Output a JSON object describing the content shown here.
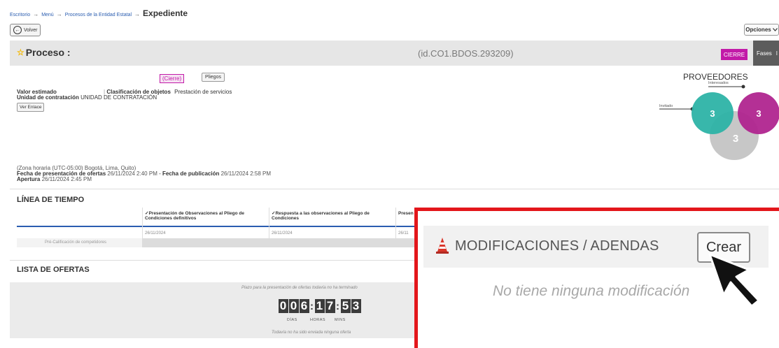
{
  "breadcrumb": {
    "items": [
      "Escritorio",
      "Menú",
      "Procesos de la Entidad Estatal"
    ],
    "current": "Expediente",
    "separator": "→"
  },
  "toolbar": {
    "back_label": "Volver",
    "options_label": "Opciones"
  },
  "process": {
    "title": "Proceso :",
    "id": "(id.CO1.BDOS.293209)",
    "badge": "CIERRE",
    "fases_label": "Fases",
    "state_label": "(Cierre)",
    "pliegos_label": "Pliegos",
    "valor_estimado_label": "Valor estimado",
    "clasificacion_label": "Clasificación de objetos",
    "clasificacion_value": "Prestación de servicios",
    "unidad_label": "Unidad de contratación",
    "unidad_value": "UNIDAD DE CONTRATACIÓN",
    "ver_enlace_label": "Ver Enlace",
    "zona_horaria": "(Zona horaria (UTC-05:00) Bogotá, Lima, Quito)",
    "fecha_presentacion_label": "Fecha de presentación de ofertas",
    "fecha_presentacion_value": "26/11/2024 2:40 PM",
    "dash": "-",
    "fecha_publicacion_label": "Fecha de publicación",
    "fecha_publicacion_value": "26/11/2024 2:58 PM",
    "apertura_label": "Apertura",
    "apertura_value": "26/11/2024 2:45 PM"
  },
  "proveedores": {
    "title": "PROVEEDORES",
    "interesados_label": "Interesados",
    "invitado_label": "Invitado",
    "counts": [
      "3",
      "3",
      "3"
    ],
    "colors": {
      "teal": "#2db3a7",
      "magenta": "#b0258f",
      "gray": "#c4c4c4"
    }
  },
  "timeline": {
    "title": "LÍNEA DE TIEMPO",
    "columns": [
      "Presentación de Observaciones al Pliego de Condiciones definitivos",
      "Respuesta a las observaciones al Pliego de Condiciones",
      "Presen"
    ],
    "dates": [
      "26/11/2024",
      "26/11/2024",
      "26/11"
    ],
    "row_label": "Pré-Calificación de competidores"
  },
  "offers": {
    "title": "LISTA DE OFERTAS",
    "notice": "Plazo para la presentación de ofertas todavía no ha terminado",
    "countdown": {
      "days": [
        "0",
        "0",
        "6"
      ],
      "hours": [
        "1",
        "7"
      ],
      "mins": [
        "5",
        "3"
      ]
    },
    "labels": {
      "days": "DÍAS",
      "hours": "HORAS",
      "mins": "MINS"
    },
    "none_sent": "Todavía no ha sido enviada ninguna oferta"
  },
  "modificaciones": {
    "title": "MODIFICACIONES / ADENDAS",
    "create_label": "Crear",
    "empty": "No tiene ninguna modificación"
  },
  "theme": {
    "highlight_border": "#e3161b",
    "accent": "#c21aa8",
    "link": "#2a5db0"
  }
}
